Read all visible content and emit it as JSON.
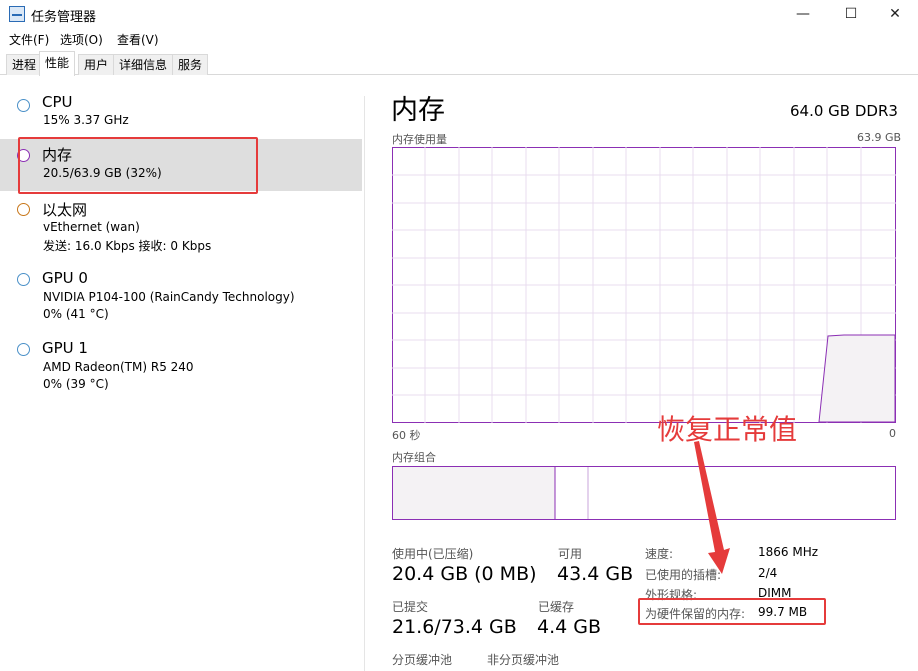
{
  "window": {
    "title": "任务管理器",
    "controls": {
      "minimize": "—",
      "maximize": "☐",
      "close": "✕"
    }
  },
  "menu": [
    "文件(F)",
    "选项(O)",
    "查看(V)"
  ],
  "tabs": [
    {
      "label": "进程",
      "active": false
    },
    {
      "label": "性能",
      "active": true
    },
    {
      "label": "用户",
      "active": false
    },
    {
      "label": "详细信息",
      "active": false
    },
    {
      "label": "服务",
      "active": false
    }
  ],
  "resources": [
    {
      "name": "CPU",
      "sub1": "15% 3.37 GHz",
      "sub2": "",
      "circle_color": "#4a90c8"
    },
    {
      "name": "内存",
      "sub1": "20.5/63.9 GB (32%)",
      "sub2": "",
      "circle_color": "#8b2fb4"
    },
    {
      "name": "以太网",
      "sub1": "vEthernet (wan)",
      "sub2": "发送: 16.0 Kbps 接收: 0 Kbps",
      "circle_color": "#c8771a"
    },
    {
      "name": "GPU 0",
      "sub1": "NVIDIA P104-100 (RainCandy Technology)",
      "sub2": "0% (41 °C)",
      "circle_color": "#4a90c8"
    },
    {
      "name": "GPU 1",
      "sub1": "AMD Radeon(TM) R5 240",
      "sub2": "0% (39 °C)",
      "circle_color": "#4a90c8"
    }
  ],
  "detail": {
    "title": "内存",
    "spec": "64.0 GB DDR3",
    "usage_graph": {
      "label": "内存使用量",
      "max_label": "63.9 GB",
      "time_left": "60 秒",
      "time_right": "0"
    },
    "composition_label": "内存组合",
    "stats": {
      "in_use_label": "使用中(已压缩)",
      "in_use_value": "20.4 GB (0 MB)",
      "available_label": "可用",
      "available_value": "43.4 GB",
      "committed_label": "已提交",
      "committed_value": "21.6/73.4 GB",
      "cached_label": "已缓存",
      "cached_value": "4.4 GB",
      "paged_pool_label": "分页缓冲池",
      "nonpaged_pool_label": "非分页缓冲池"
    },
    "side": [
      {
        "label": "速度:",
        "value": "1866 MHz"
      },
      {
        "label": "已使用的插槽:",
        "value": "2/4"
      },
      {
        "label": "外形规格:",
        "value": "DIMM"
      },
      {
        "label": "为硬件保留的内存:",
        "value": "99.7 MB"
      }
    ]
  },
  "annotation": {
    "text": "恢复正常值",
    "color": "#e53b3b"
  },
  "colors": {
    "memory_line": "#8b2fb4",
    "memory_fill": "#f4f2f4",
    "grid": "#e8dcef"
  }
}
